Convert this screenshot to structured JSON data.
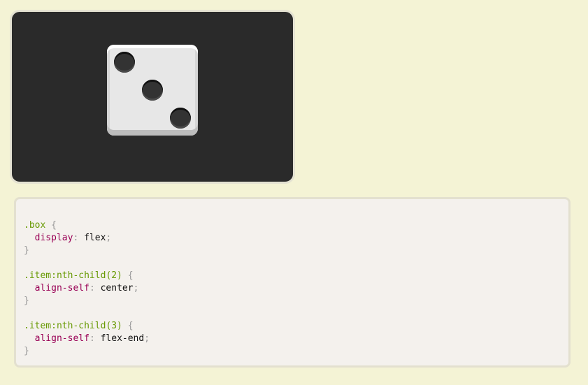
{
  "demo": {
    "pip_count": 3,
    "colors": {
      "background": "#f4f3d5",
      "panel": "#2a2a2a",
      "die_face": "#e7e7e7",
      "pip": "#333333"
    }
  },
  "code": {
    "colors": {
      "selector": "#669900",
      "property": "#990055",
      "punctuation": "#999999",
      "value": "#111111",
      "background": "#f4f1ed"
    },
    "rules": [
      {
        "selector": ".box",
        "open": "{",
        "property": "display",
        "colon": ":",
        "value": "flex",
        "semicolon": ";",
        "close": "}"
      },
      {
        "selector": ".item:nth-child(2)",
        "open": "{",
        "property": "align-self",
        "colon": ":",
        "value": "center",
        "semicolon": ";",
        "close": "}"
      },
      {
        "selector": ".item:nth-child(3)",
        "open": "{",
        "property": "align-self",
        "colon": ":",
        "value": "flex-end",
        "semicolon": ";",
        "close": "}"
      }
    ]
  }
}
